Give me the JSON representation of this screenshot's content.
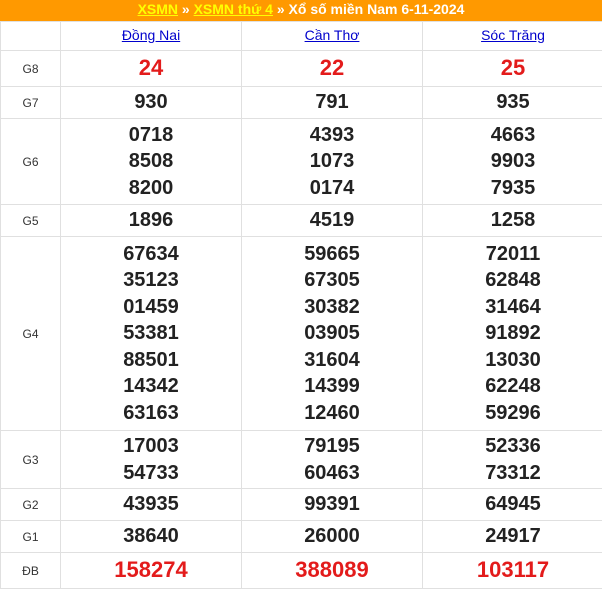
{
  "breadcrumb": {
    "link1": "XSMN",
    "sep1": "»",
    "link2": "XSMN thứ 4",
    "sep2": "»",
    "current": "Xổ số miền Nam 6-11-2024"
  },
  "provinces": [
    "Đồng Nai",
    "Cần Thơ",
    "Sóc Trăng"
  ],
  "prizes": [
    {
      "label": "G8",
      "values": [
        [
          "24"
        ],
        [
          "22"
        ],
        [
          "25"
        ]
      ]
    },
    {
      "label": "G7",
      "values": [
        [
          "930"
        ],
        [
          "791"
        ],
        [
          "935"
        ]
      ]
    },
    {
      "label": "G6",
      "values": [
        [
          "0718",
          "8508",
          "8200"
        ],
        [
          "4393",
          "1073",
          "0174"
        ],
        [
          "4663",
          "9903",
          "7935"
        ]
      ]
    },
    {
      "label": "G5",
      "values": [
        [
          "1896"
        ],
        [
          "4519"
        ],
        [
          "1258"
        ]
      ]
    },
    {
      "label": "G4",
      "values": [
        [
          "67634",
          "35123",
          "01459",
          "53381",
          "88501",
          "14342",
          "63163"
        ],
        [
          "59665",
          "67305",
          "30382",
          "03905",
          "31604",
          "14399",
          "12460"
        ],
        [
          "72011",
          "62848",
          "31464",
          "91892",
          "13030",
          "62248",
          "59296"
        ]
      ]
    },
    {
      "label": "G3",
      "values": [
        [
          "17003",
          "54733"
        ],
        [
          "79195",
          "60463"
        ],
        [
          "52336",
          "73312"
        ]
      ]
    },
    {
      "label": "G2",
      "values": [
        [
          "43935"
        ],
        [
          "99391"
        ],
        [
          "64945"
        ]
      ]
    },
    {
      "label": "G1",
      "values": [
        [
          "38640"
        ],
        [
          "26000"
        ],
        [
          "24917"
        ]
      ]
    },
    {
      "label": "ĐB",
      "values": [
        [
          "158274"
        ],
        [
          "388089"
        ],
        [
          "103117"
        ]
      ]
    }
  ],
  "colors": {
    "title_bg": "#ff9900",
    "link": "#0000cc",
    "highlight": "#e31b1b"
  }
}
